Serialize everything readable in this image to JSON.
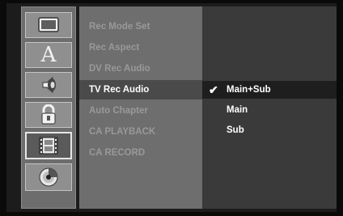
{
  "icon_column": {
    "icons": [
      {
        "name": "display-icon"
      },
      {
        "name": "language-icon",
        "glyph": "A"
      },
      {
        "name": "audio-icon"
      },
      {
        "name": "lock-icon"
      },
      {
        "name": "recording-film-icon"
      },
      {
        "name": "disc-icon"
      }
    ]
  },
  "menu": {
    "items": [
      {
        "label": "Rec Mode Set"
      },
      {
        "label": "Rec Aspect"
      },
      {
        "label": "DV Rec Audio"
      },
      {
        "label": "TV Rec Audio"
      },
      {
        "label": "Auto Chapter"
      },
      {
        "label": "CA PLAYBACK"
      },
      {
        "label": "CA RECORD"
      }
    ]
  },
  "options": {
    "check_mark": "✔",
    "items": [
      {
        "label": "Main+Sub"
      },
      {
        "label": "Main"
      },
      {
        "label": "Sub"
      }
    ]
  }
}
